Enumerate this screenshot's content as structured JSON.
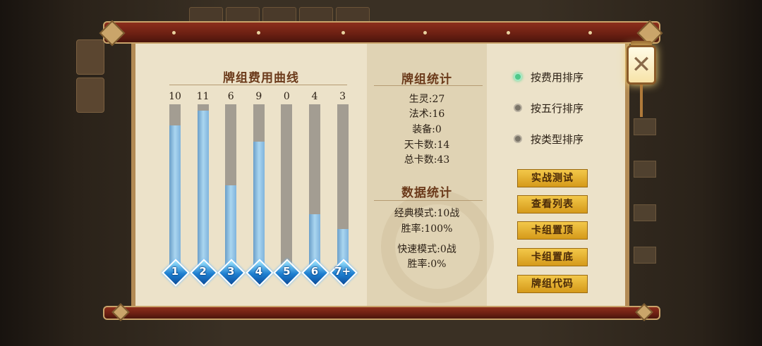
{
  "cost_chart": {
    "title": "牌组费用曲线"
  },
  "chart_data": {
    "type": "bar",
    "categories": [
      "1",
      "2",
      "3",
      "4",
      "5",
      "6",
      "7+"
    ],
    "values": [
      10,
      11,
      6,
      9,
      0,
      4,
      3
    ],
    "fill_fractions": [
      0.87,
      0.96,
      0.5,
      0.77,
      0,
      0.32,
      0.23
    ],
    "title": "牌组费用曲线"
  },
  "deck_stats": {
    "title": "牌组统计",
    "creature": "生灵:27",
    "spell": "法术:16",
    "equipment": "装备:0",
    "heaven_cards": "天卡数:14",
    "total_cards": "总卡数:43"
  },
  "data_stats": {
    "title": "数据统计",
    "classic_mode": "经典模式:10战",
    "classic_winrate": "胜率:100%",
    "quick_mode": "快速模式:0战",
    "quick_winrate": "胜率:0%"
  },
  "sort_options": [
    {
      "label": "按费用排序",
      "selected": true
    },
    {
      "label": "按五行排序",
      "selected": false
    },
    {
      "label": "按类型排序",
      "selected": false
    }
  ],
  "actions": {
    "battle_test": "实战测试",
    "view_list": "查看列表",
    "pin_top": "卡组置顶",
    "pin_bottom": "卡组置底",
    "deck_code": "牌组代码"
  },
  "colors": {
    "accent_gold": "#e0ad2c",
    "bar_blue": "#8cc4e8",
    "radio_on": "#4fc88a",
    "title_brown": "#6b3a1a"
  }
}
